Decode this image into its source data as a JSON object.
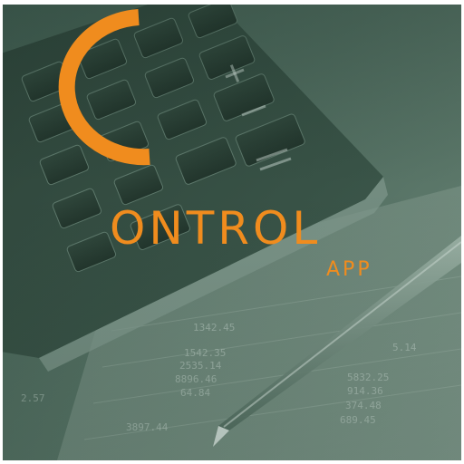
{
  "logo": {
    "wordmark": "ONTROL",
    "subtitle": "APP",
    "initial_icon": "c-arc-icon"
  },
  "background": {
    "photo_numbers": [
      "1342.45",
      "1542.35",
      "2535.14",
      "8896.46",
      "64.84",
      "5832.25",
      "914.36",
      "374.48",
      "689.45",
      "3897.44",
      "5.14",
      "2.57"
    ]
  },
  "colors": {
    "accent": "#f08c1e",
    "scene": "#4d695c"
  }
}
